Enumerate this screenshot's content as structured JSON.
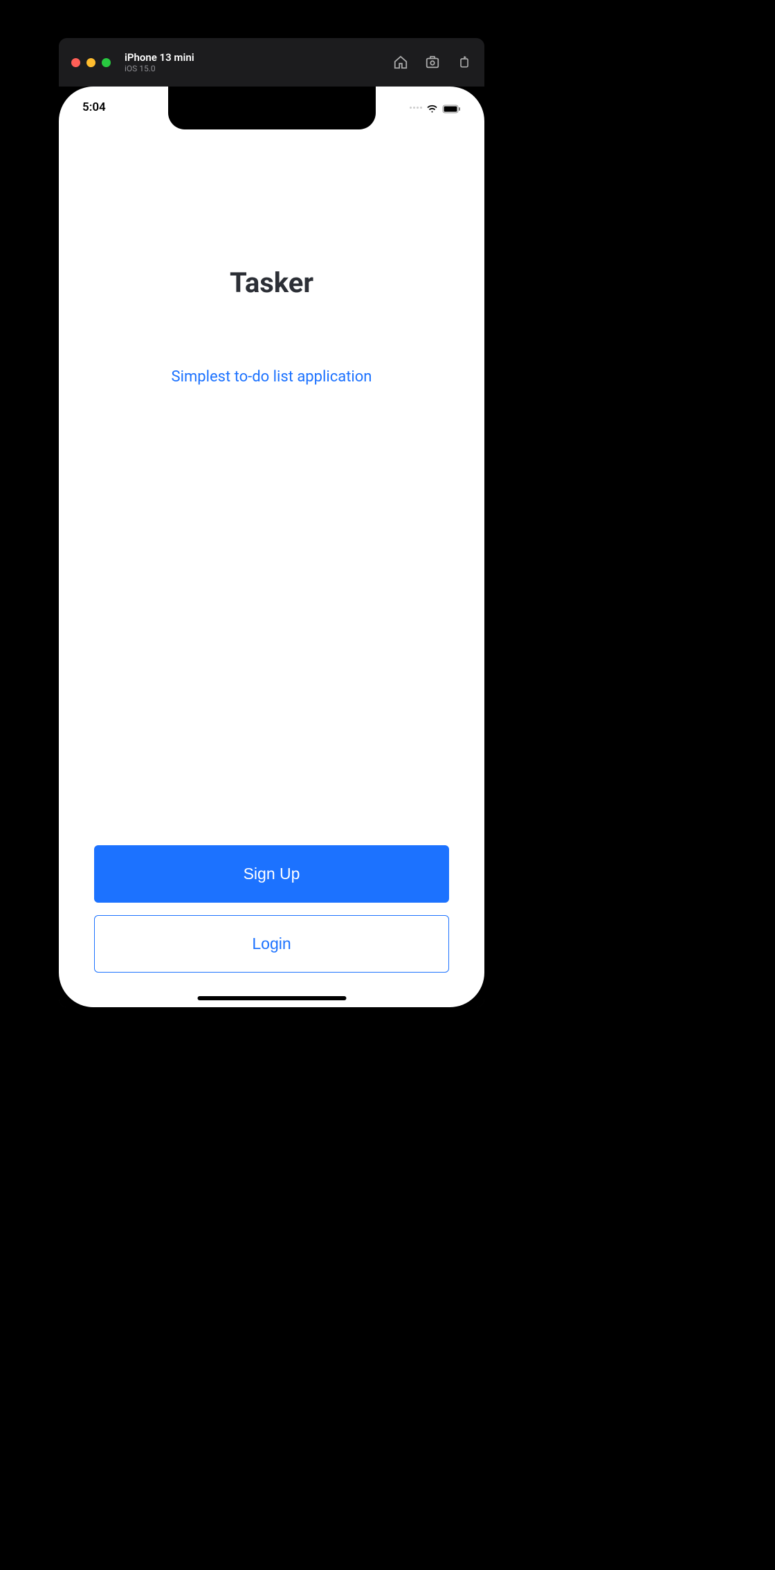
{
  "simulator": {
    "device_name": "iPhone 13 mini",
    "os_version": "iOS 15.0"
  },
  "status_bar": {
    "time": "5:04"
  },
  "app": {
    "title": "Tasker",
    "subtitle": "Simplest to-do list application"
  },
  "buttons": {
    "signup_label": "Sign Up",
    "login_label": "Login"
  }
}
